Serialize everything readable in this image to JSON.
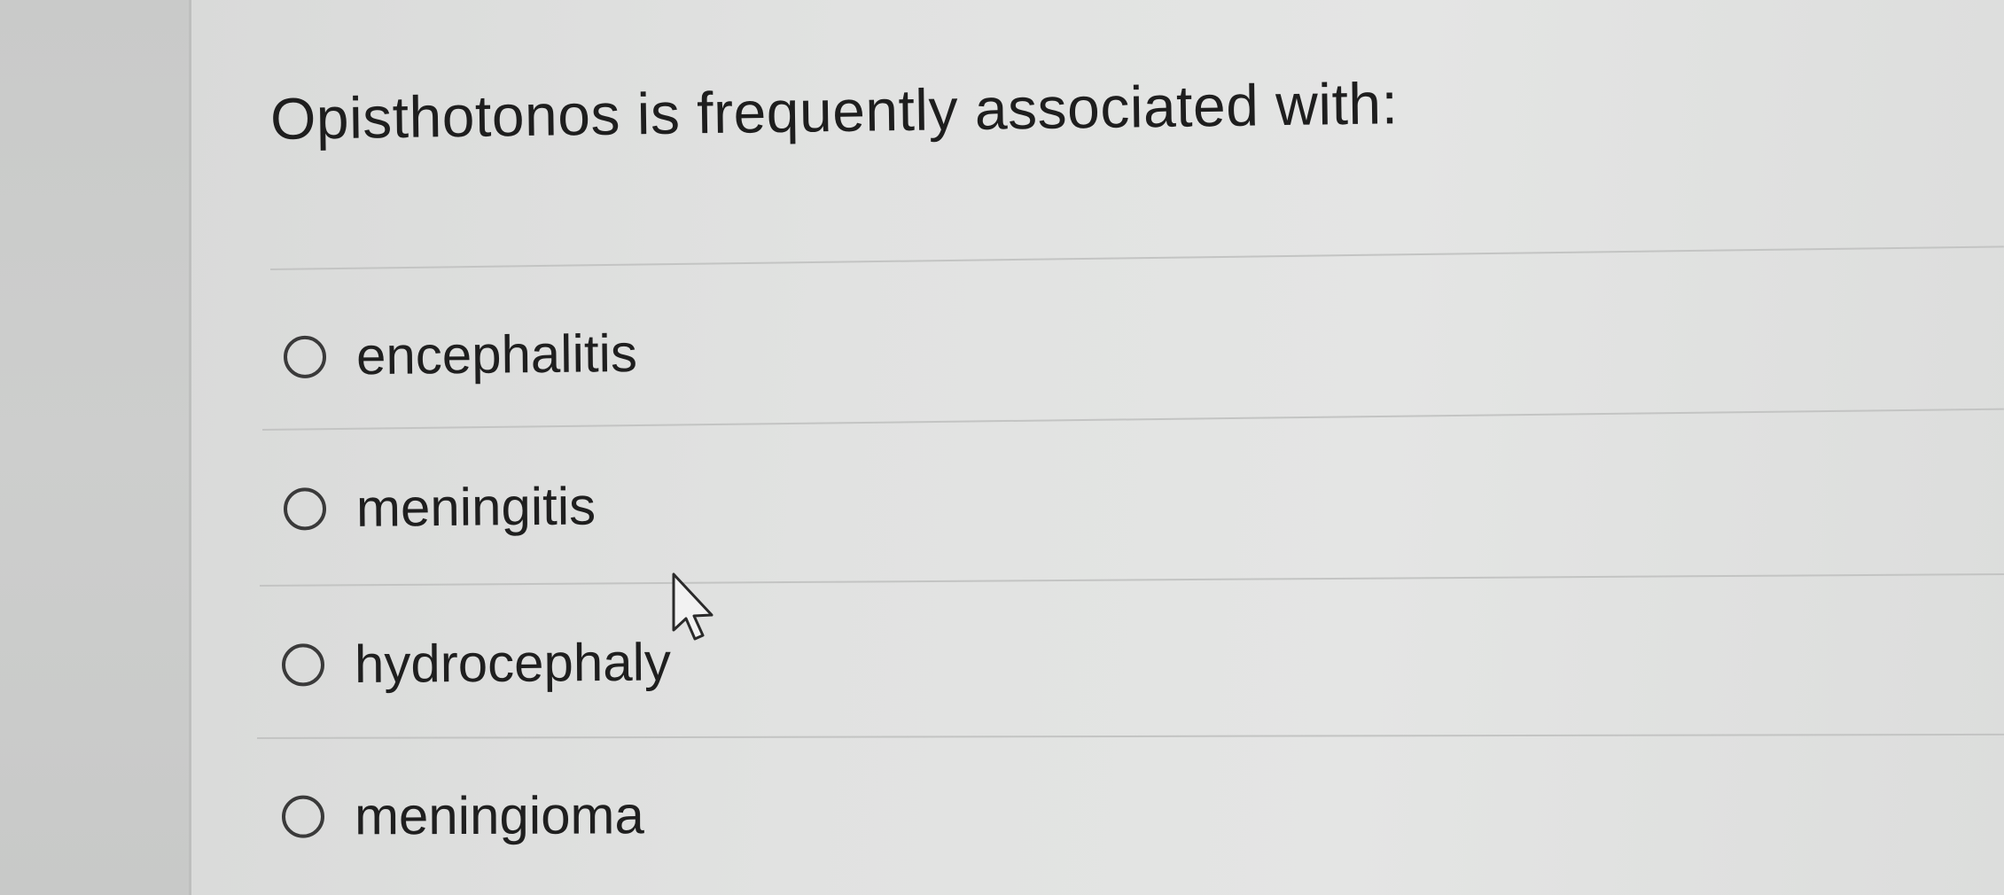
{
  "question": {
    "text": "Opisthotonos is frequently associated with:"
  },
  "options": [
    {
      "label": "encephalitis",
      "selected": false
    },
    {
      "label": "meningitis",
      "selected": false
    },
    {
      "label": "hydrocephaly",
      "selected": false
    },
    {
      "label": "meningioma",
      "selected": false
    }
  ],
  "cursor": {
    "icon": "mouse-pointer-icon"
  }
}
